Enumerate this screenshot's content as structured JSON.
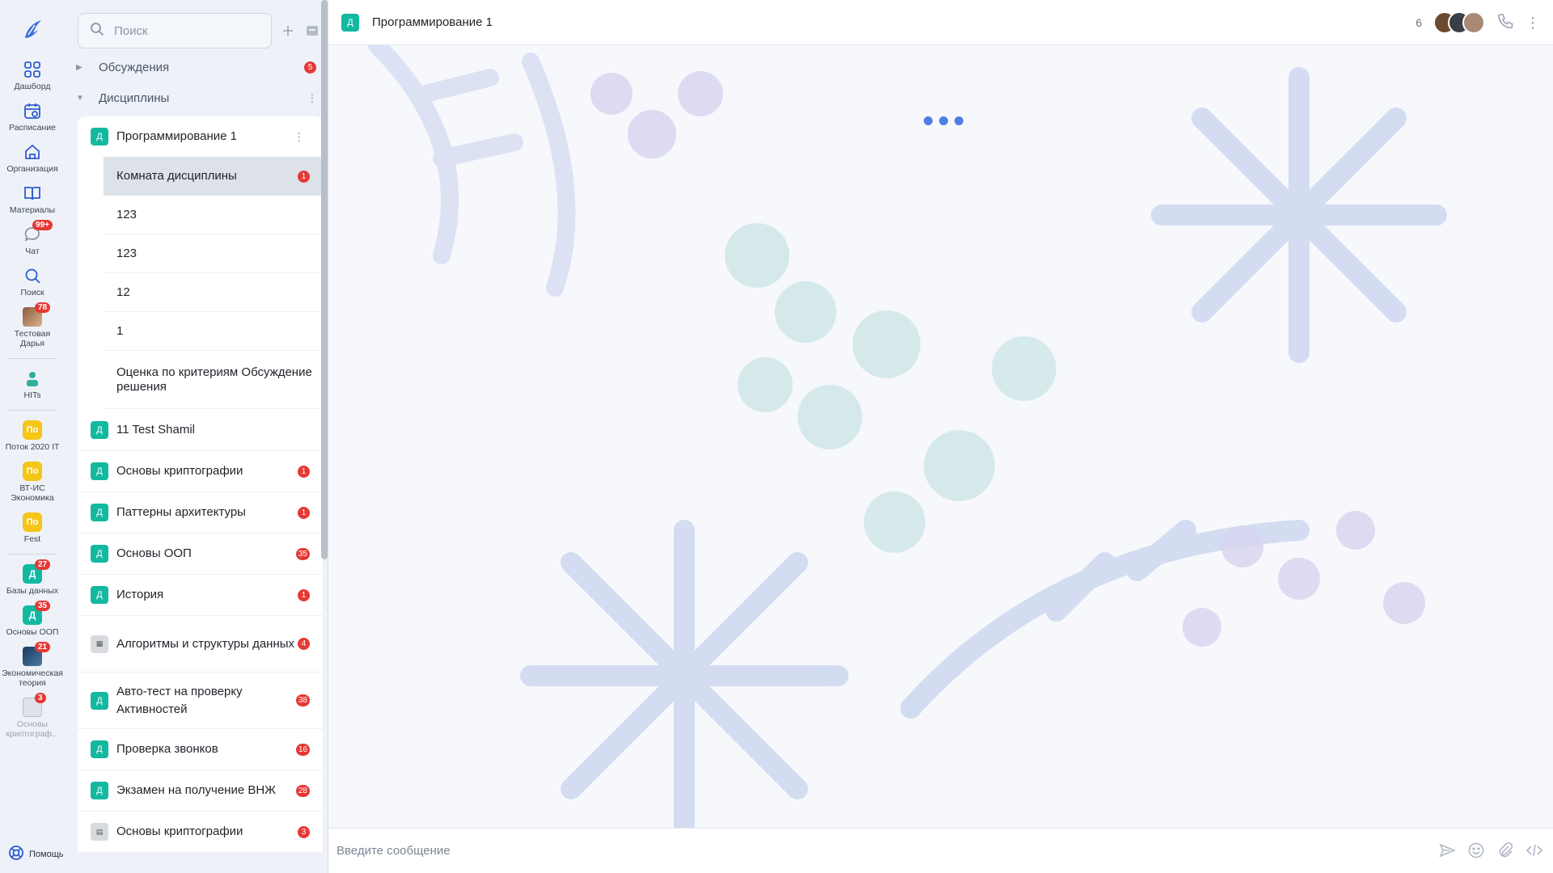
{
  "rail": {
    "items": [
      {
        "label": "Дашборд",
        "icon": "dashboard-icon"
      },
      {
        "label": "Расписание",
        "icon": "calendar-icon"
      },
      {
        "label": "Организация",
        "icon": "home-icon"
      },
      {
        "label": "Материалы",
        "icon": "book-icon"
      },
      {
        "label": "Чат",
        "icon": "chat-icon",
        "badge": "99+"
      },
      {
        "label": "Поиск",
        "icon": "search-icon"
      },
      {
        "label": "Тестовая Дарья",
        "icon": "thumbnail",
        "badge": "78"
      }
    ],
    "spaces": [
      {
        "label": "HITs",
        "icon": "thumbnail"
      },
      {
        "label": "Поток 2020 IT",
        "avatar_text": "По"
      },
      {
        "label": "ВТ-ИС Экономика",
        "avatar_text": "По"
      },
      {
        "label": "Fest",
        "avatar_text": "По"
      }
    ],
    "courses": [
      {
        "label": "Базы данных",
        "avatar_text": "Д",
        "badge": "27"
      },
      {
        "label": "Основы ООП",
        "avatar_text": "Д",
        "badge": "35"
      },
      {
        "label": "Экономическая теория",
        "icon": "thumbnail",
        "badge": "21"
      },
      {
        "label": "Основы криптограф...",
        "icon": "thumbnail",
        "badge": "3"
      }
    ],
    "help_label": "Помощь"
  },
  "sidebar": {
    "search_placeholder": "Поиск",
    "groups": [
      {
        "label": "Обсуждения",
        "badge": "5",
        "expanded": false
      },
      {
        "label": "Дисциплины",
        "expanded": true
      }
    ],
    "current": {
      "avatar_text": "Д",
      "name": "Программирование 1",
      "rooms": [
        {
          "name": "Комната дисциплины",
          "badge": "1",
          "active": true
        },
        {
          "name": "123"
        },
        {
          "name": "123"
        },
        {
          "name": "12"
        },
        {
          "name": "1"
        },
        {
          "name": "Оценка по критериям",
          "sub": "Обсуждение решения"
        }
      ]
    },
    "channels": [
      {
        "name": "11 Test Shamil",
        "avatar_text": "Д"
      },
      {
        "name": "Основы криптографии",
        "avatar_text": "Д",
        "badge": "1"
      },
      {
        "name": "Паттерны архитектуры",
        "avatar_text": "Д",
        "badge": "1"
      },
      {
        "name": "Основы ООП",
        "avatar_text": "Д",
        "badge": "35"
      },
      {
        "name": "История",
        "avatar_text": "Д",
        "badge": "1"
      },
      {
        "name": "Алгоритмы и структуры данных",
        "avatar_text": "",
        "badge": "4"
      },
      {
        "name": "Авто-тест на проверку Активностей",
        "avatar_text": "Д",
        "badge": "38"
      },
      {
        "name": "Проверка звонков",
        "avatar_text": "Д",
        "badge": "16"
      },
      {
        "name": "Экзамен на получение ВНЖ",
        "avatar_text": "Д",
        "badge": "28"
      },
      {
        "name": "Основы криптографии",
        "avatar_text": "",
        "badge": "3"
      }
    ]
  },
  "header": {
    "avatar_text": "Д",
    "title": "Программирование 1",
    "member_count": "6"
  },
  "composer": {
    "placeholder": "Введите сообщение"
  },
  "colors": {
    "accent": "#13b8a0",
    "badge": "#e53935",
    "loader": "#4f7ee6",
    "space_avatar": "#f5c518"
  }
}
